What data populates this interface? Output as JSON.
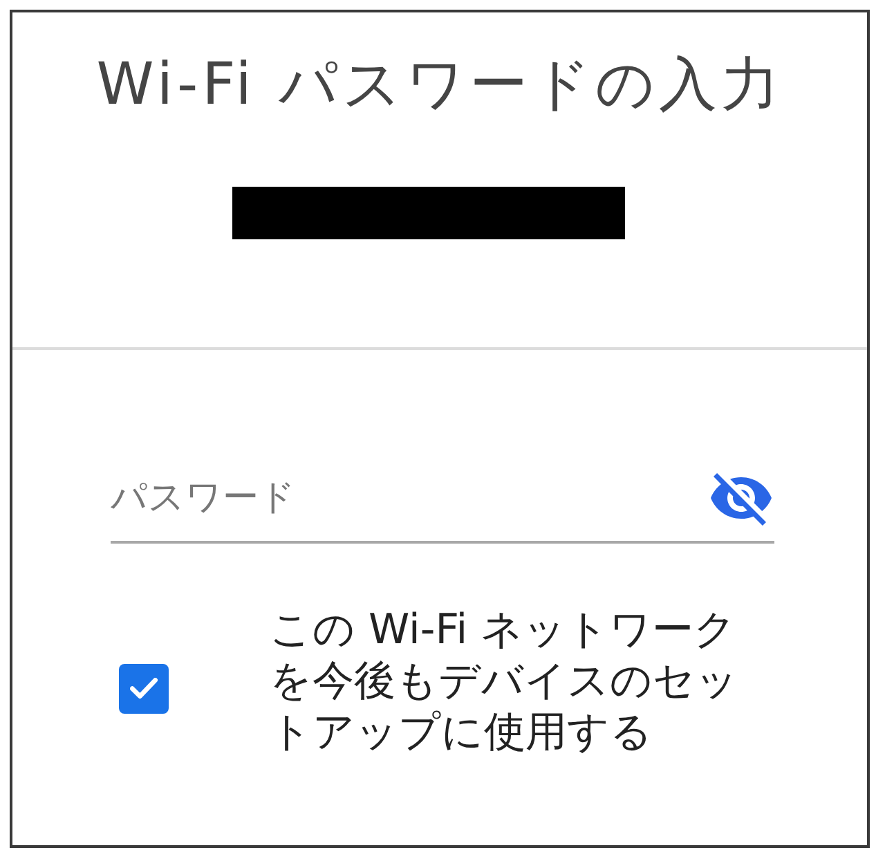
{
  "dialog": {
    "title": "Wi-Fi パスワードの入力"
  },
  "password_field": {
    "placeholder": "パスワード",
    "password_visible": false
  },
  "remember_option": {
    "label": "この Wi-Fi ネットワークを今後もデバイスのセットアップに使用する",
    "checked": true
  }
}
